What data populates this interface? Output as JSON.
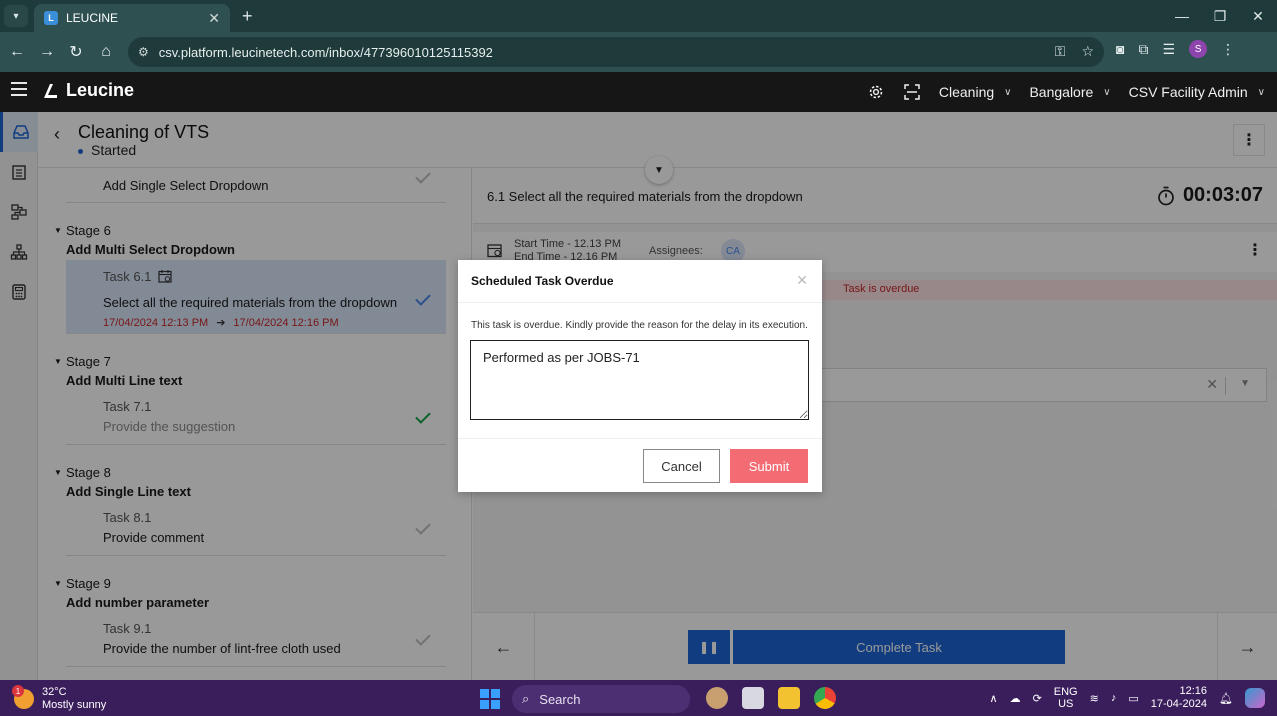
{
  "browser": {
    "tab_title": "LEUCINE",
    "tab_favicon": "L",
    "url": "csv.platform.leucinetech.com/inbox/477396010125115392",
    "profile_initial": "S"
  },
  "app": {
    "brand": "Leucine",
    "header_dropdowns": [
      "Cleaning",
      "Bangalore",
      "CSV Facility Admin"
    ]
  },
  "page": {
    "title": "Cleaning of VTS",
    "status": "Started"
  },
  "stages": {
    "partial_task": "Add Single Select Dropdown",
    "list": [
      {
        "label": "Stage 6",
        "name": "Add Multi Select Dropdown",
        "task_num": "Task 6.1",
        "task_desc": "Select all the required materials from the dropdown",
        "start": "17/04/2024 12:13 PM",
        "end": "17/04/2024 12:16 PM"
      },
      {
        "label": "Stage 7",
        "name": "Add Multi Line text",
        "task_num": "Task 7.1",
        "task_desc": "Provide the suggestion"
      },
      {
        "label": "Stage 8",
        "name": "Add Single Line text",
        "task_num": "Task 8.1",
        "task_desc": "Provide comment"
      },
      {
        "label": "Stage 9",
        "name": "Add number parameter",
        "task_num": "Task 9.1",
        "task_desc": "Provide the number of lint-free cloth used"
      }
    ]
  },
  "task_panel": {
    "title": "6.1 Select all the required materials from the dropdown",
    "timer": "00:03:07",
    "start_time": "Start Time - 12.13 PM",
    "end_time": "End Time - 12.16 PM",
    "assignees_label": "Assignees:",
    "assignee_initials": "CA",
    "overdue_label": "Task is overdue",
    "complete_label": "Complete Task"
  },
  "modal": {
    "title": "Scheduled Task Overdue",
    "message": "This task is overdue. Kindly provide the reason for the delay in its execution.",
    "reason_value": "Performed as per JOBS-71",
    "cancel_label": "Cancel",
    "submit_label": "Submit"
  },
  "taskbar": {
    "weather_badge": "1",
    "temperature": "32°C",
    "condition": "Mostly sunny",
    "search_label": "Search",
    "lang_top": "ENG",
    "lang_bottom": "US",
    "time": "12:16",
    "date": "17-04-2024"
  },
  "colors": {
    "primary": "#1d66d6",
    "submit": "#f36b73",
    "overdue": "#c62828",
    "header_bg": "#161616"
  }
}
